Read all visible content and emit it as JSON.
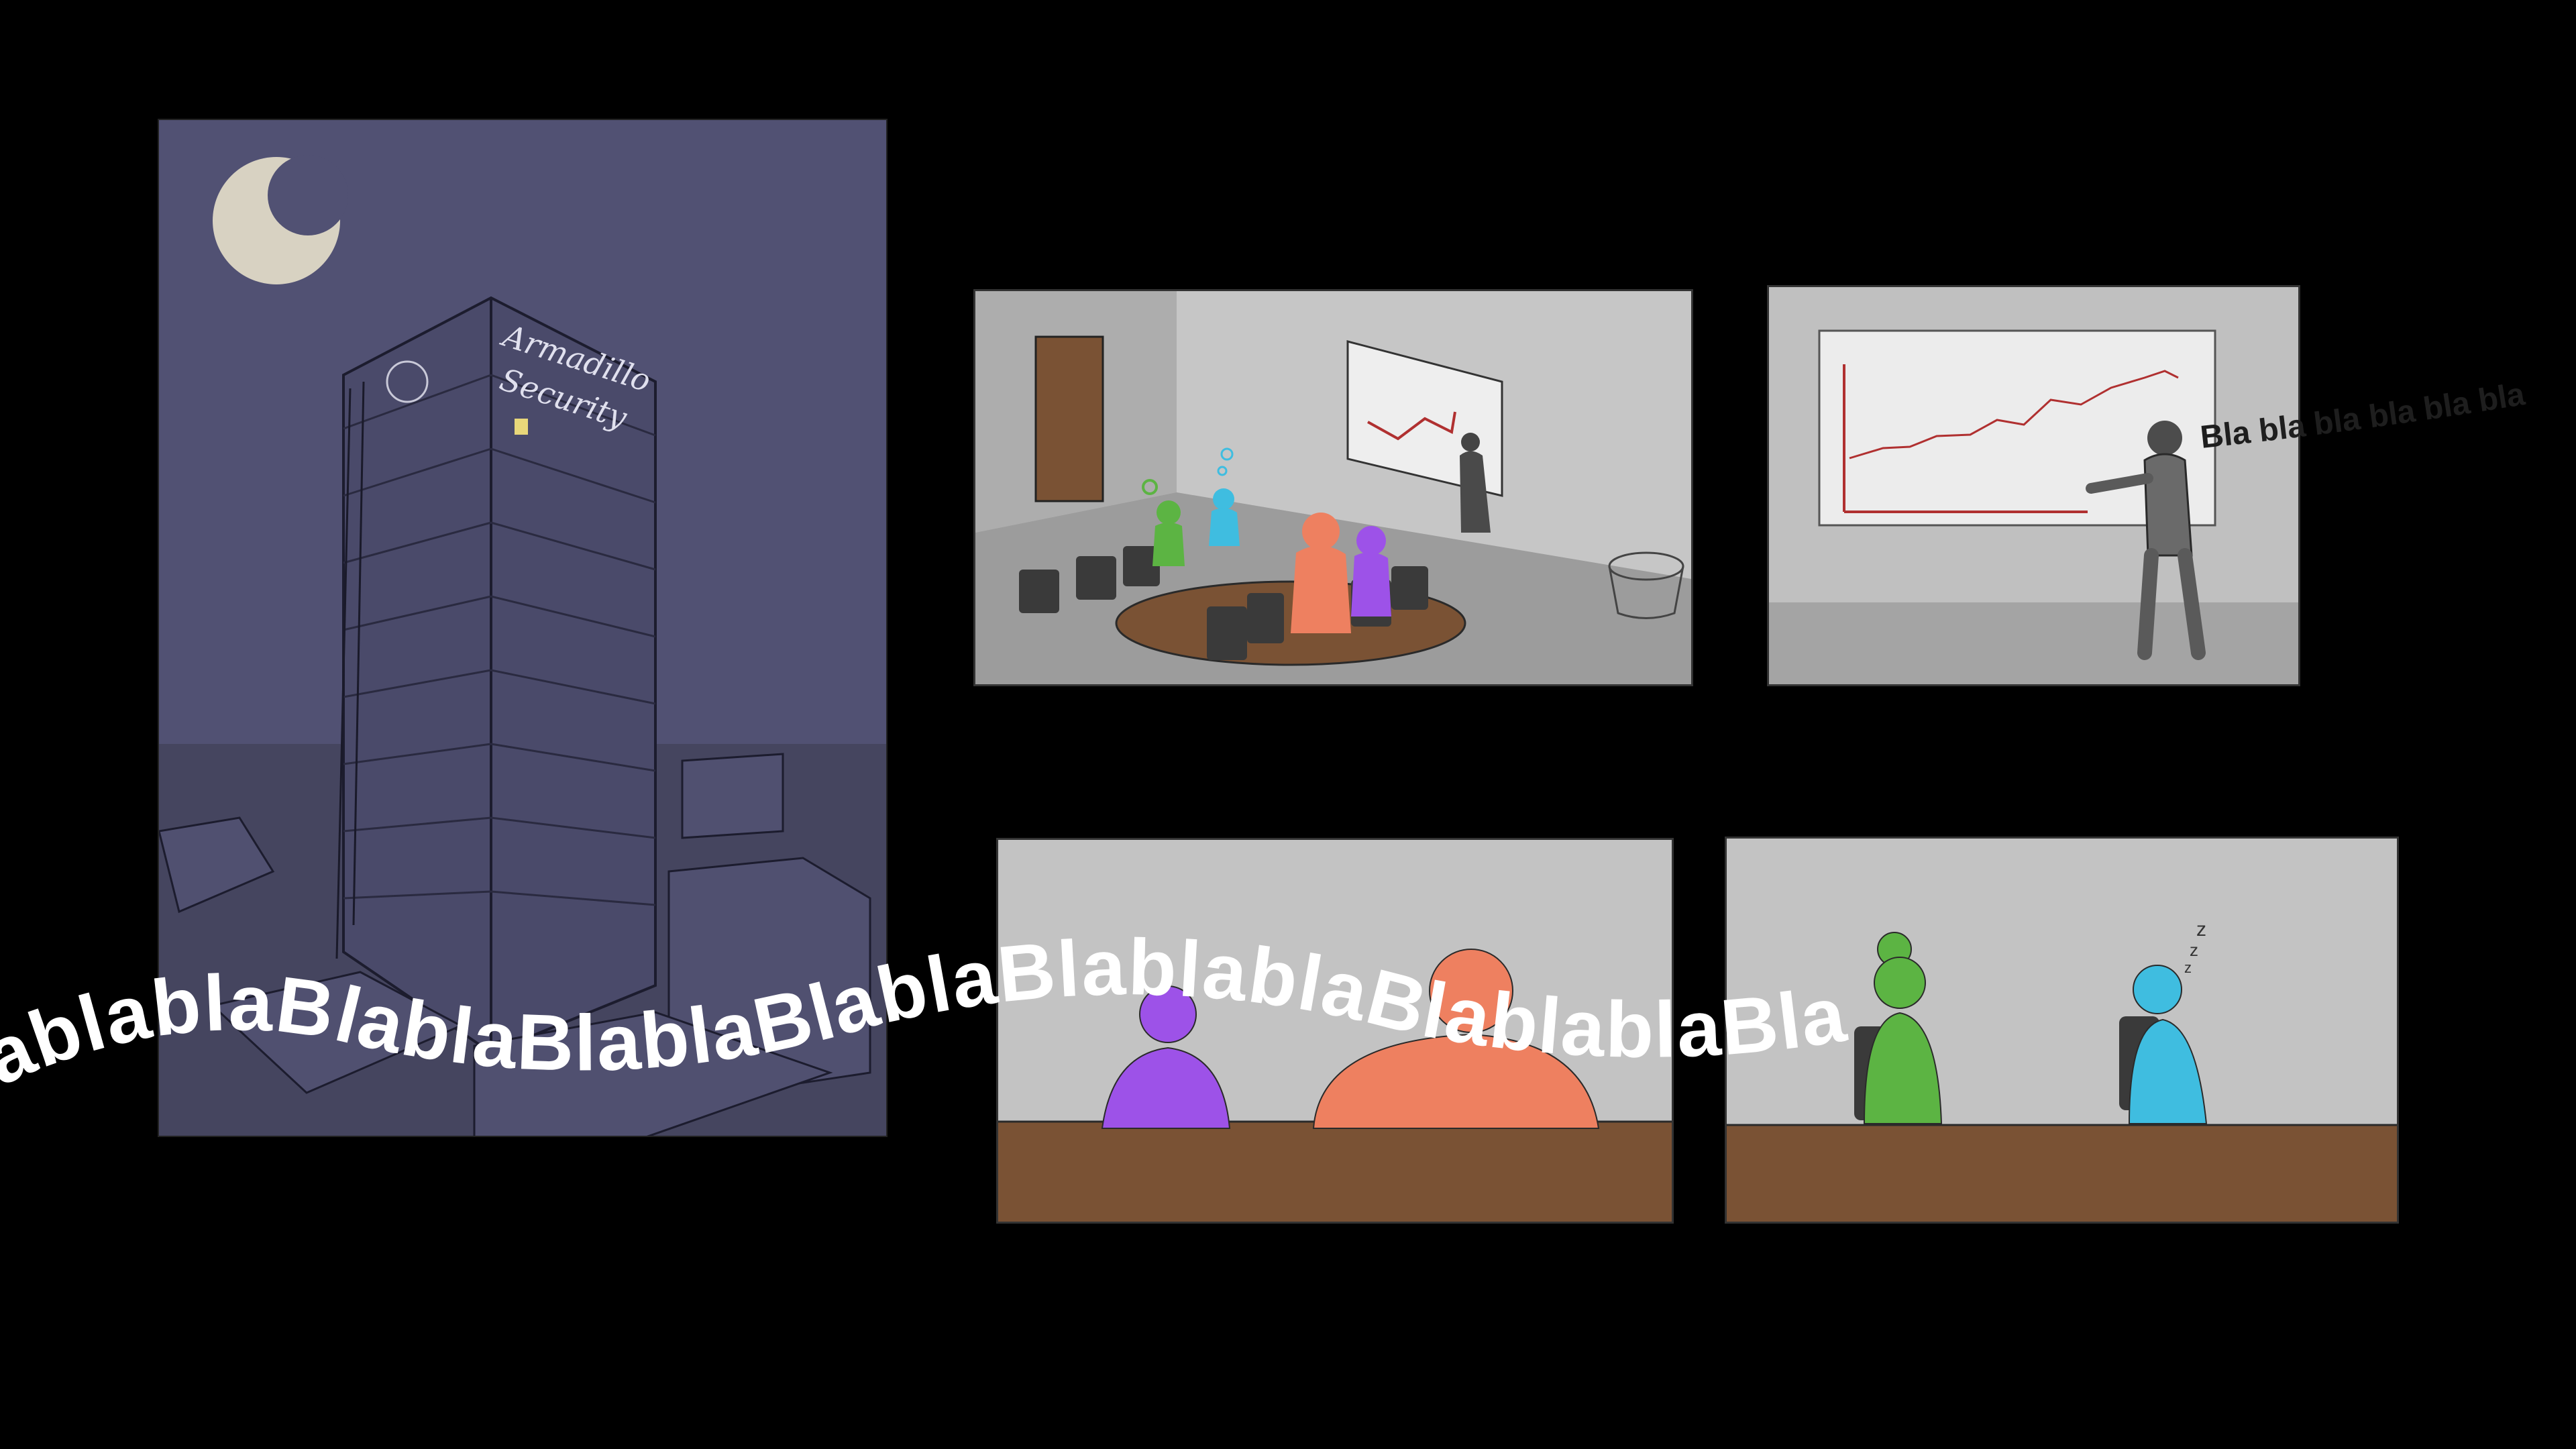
{
  "building": {
    "sign_line1": "Armadillo",
    "sign_line2": "Security"
  },
  "presenter_speech": "Bla bla bla bla bla bla",
  "wave_text": "ablablaBlablaBlablaBlablaBlablablaBlablablaBla",
  "snore": [
    "z",
    "z",
    "z"
  ],
  "colors": {
    "background": "#000000",
    "night_sky": "#515173",
    "moon": "#d8d2c2",
    "office_wall": "#c0c0c0",
    "table": "#7a5234",
    "char_purple": "#9d52e8",
    "char_orange": "#ee8060",
    "char_green": "#5cb443",
    "char_cyan": "#3fbde0",
    "chart_line": "#b03030"
  }
}
